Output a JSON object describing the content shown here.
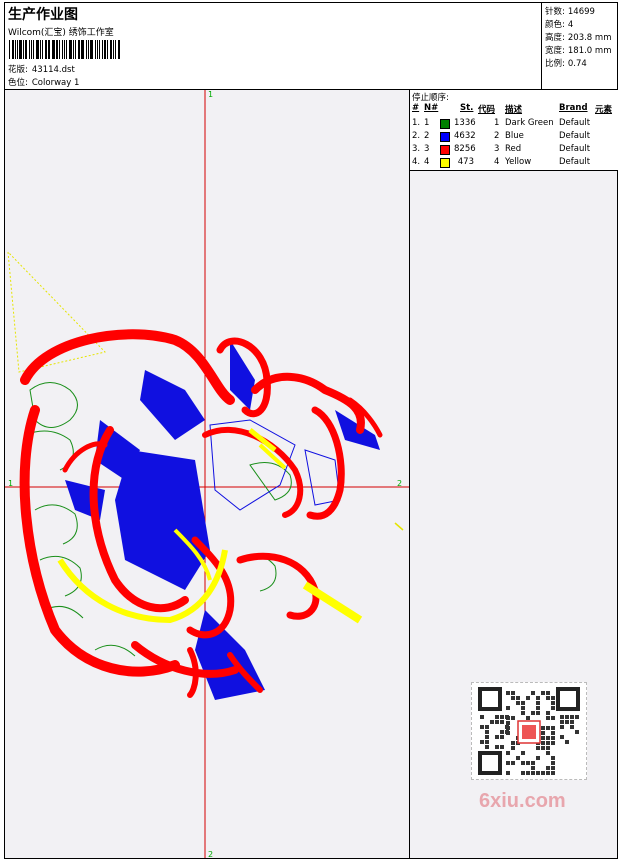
{
  "header": {
    "title": "生产作业图",
    "subtitle": "Wilcom(汇宝) 绣饰工作室",
    "design_label": "花版:",
    "design_value": "43114.dst",
    "colorway_label": "色位:",
    "colorway_value": "Colorway 1"
  },
  "stats": {
    "stitches_label": "针数:",
    "stitches": "14699",
    "colors_label": "颜色:",
    "colors": "4",
    "height_label": "高度:",
    "height": "203.8 mm",
    "width_label": "宽度:",
    "width": "181.0 mm",
    "ratio_label": "比例:",
    "ratio": "0.74"
  },
  "stop_sequence": {
    "title": "停止顺序:",
    "headers": [
      "#",
      "N#",
      "St.",
      "代码",
      "描述",
      "Brand",
      "元素"
    ],
    "rows": [
      {
        "num": "1.",
        "n": "1",
        "color": "#008000",
        "st": "1336",
        "code": "1",
        "desc": "Dark Green",
        "brand": "Default"
      },
      {
        "num": "2.",
        "n": "2",
        "color": "#0000ff",
        "st": "4632",
        "code": "2",
        "desc": "Blue",
        "brand": "Default"
      },
      {
        "num": "3.",
        "n": "3",
        "color": "#ff0000",
        "st": "8256",
        "code": "3",
        "desc": "Red",
        "brand": "Default"
      },
      {
        "num": "4.",
        "n": "4",
        "color": "#ffff00",
        "st": "473",
        "code": "4",
        "desc": "Yellow",
        "brand": "Default"
      }
    ]
  },
  "axis": {
    "top": "1",
    "bottom": "2",
    "left": "1",
    "right": "2"
  },
  "watermark": "6xiu.com"
}
